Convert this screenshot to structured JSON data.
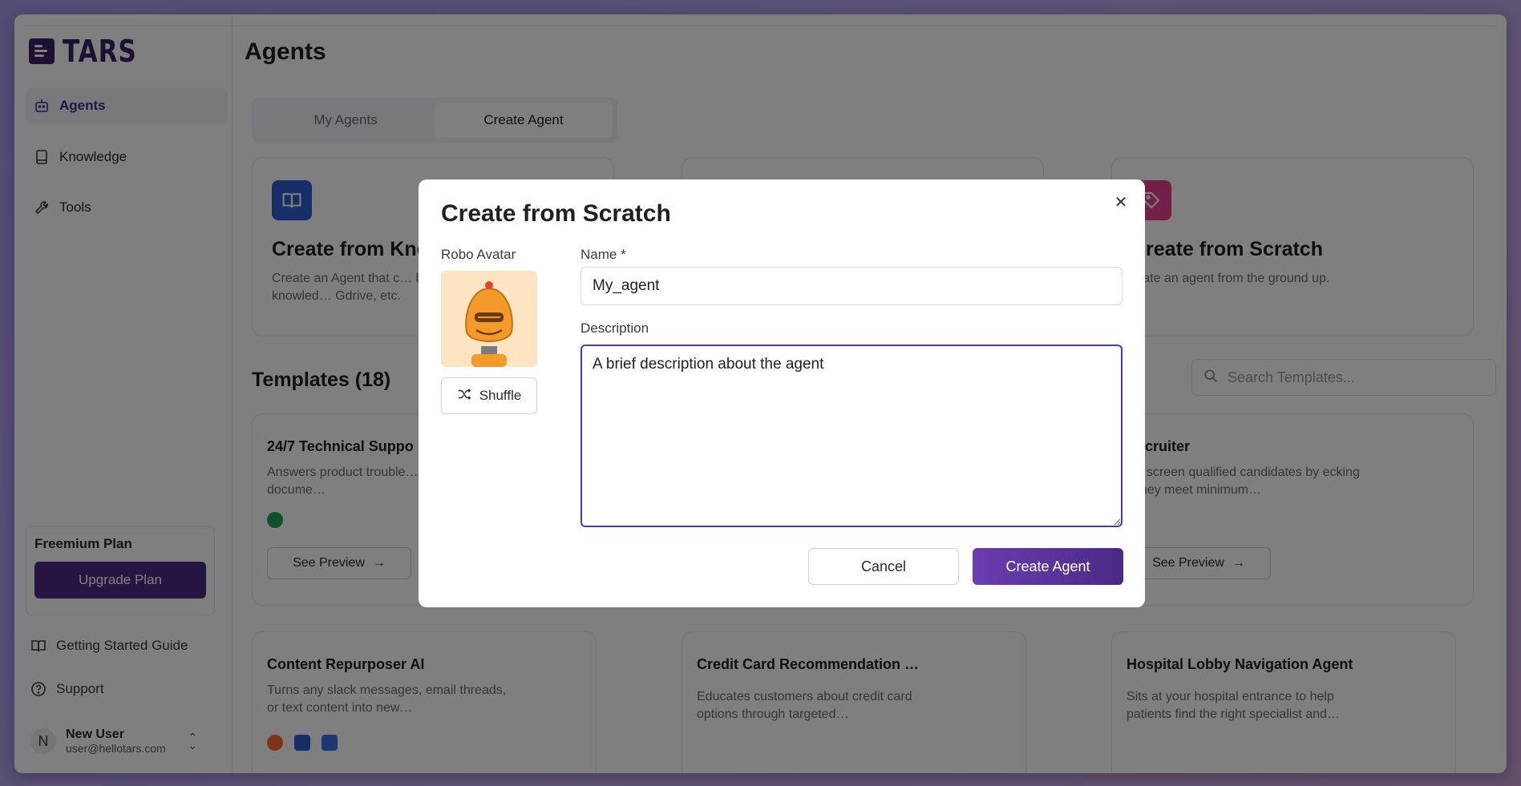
{
  "app": {
    "logo_text": "TARS"
  },
  "sidebar": {
    "items": [
      {
        "label": "Agents",
        "icon": "robot-icon",
        "active": true
      },
      {
        "label": "Knowledge",
        "icon": "book-icon",
        "active": false
      },
      {
        "label": "Tools",
        "icon": "wrench-icon",
        "active": false
      }
    ],
    "plan": {
      "title": "Freemium Plan",
      "upgrade_label": "Upgrade Plan"
    },
    "links": [
      {
        "label": "Getting Started Guide",
        "icon": "open-book-icon"
      },
      {
        "label": "Support",
        "icon": "help-circle-icon"
      }
    ],
    "user": {
      "initial": "N",
      "name": "New User",
      "email": "user@hellotars.com"
    }
  },
  "main": {
    "title": "Agents",
    "tabs": [
      {
        "label": "My Agents",
        "active": false
      },
      {
        "label": "Create Agent",
        "active": true
      }
    ],
    "create_cards": [
      {
        "title": "Create from Kno",
        "desc": "Create an Agent that c… based on the knowled… Gdrive, etc.",
        "icon": "book-open-icon"
      },
      {
        "title": "",
        "desc": "",
        "icon": ""
      },
      {
        "title": "Create from Scratch",
        "desc": "reate an agent from the ground up.",
        "icon": "tag-icon"
      }
    ],
    "templates_title": "Templates (18)",
    "search_placeholder": "Search Templates...",
    "templates": [
      {
        "title": "24/7 Technical Suppo",
        "desc": "Answers product trouble… questions from docume…",
        "preview_label": "See Preview"
      },
      {
        "title": "Recruiter",
        "desc": "lps screen qualified candidates by ecking if they meet minimum…",
        "preview_label": "See Preview"
      },
      {
        "title": "Content Repurposer AI",
        "desc": "Turns any slack messages, email threads, or text content into new…"
      },
      {
        "title": "Credit Card Recommendation …",
        "desc": "Educates customers about credit card options through targeted…"
      },
      {
        "title": "Hospital Lobby Navigation Agent",
        "desc": "Sits at your hospital entrance to help patients find the right specialist and…"
      }
    ]
  },
  "modal": {
    "title": "Create from Scratch",
    "avatar_label": "Robo Avatar",
    "shuffle_label": "Shuffle",
    "name_label": "Name *",
    "name_value": "My_agent",
    "description_label": "Description",
    "description_value": "A brief description about the agent",
    "cancel_label": "Cancel",
    "create_label": "Create Agent"
  },
  "colors": {
    "brand": "#4b2a86",
    "accent": "#5b34a3",
    "avatar_bg": "#fde5c4"
  }
}
